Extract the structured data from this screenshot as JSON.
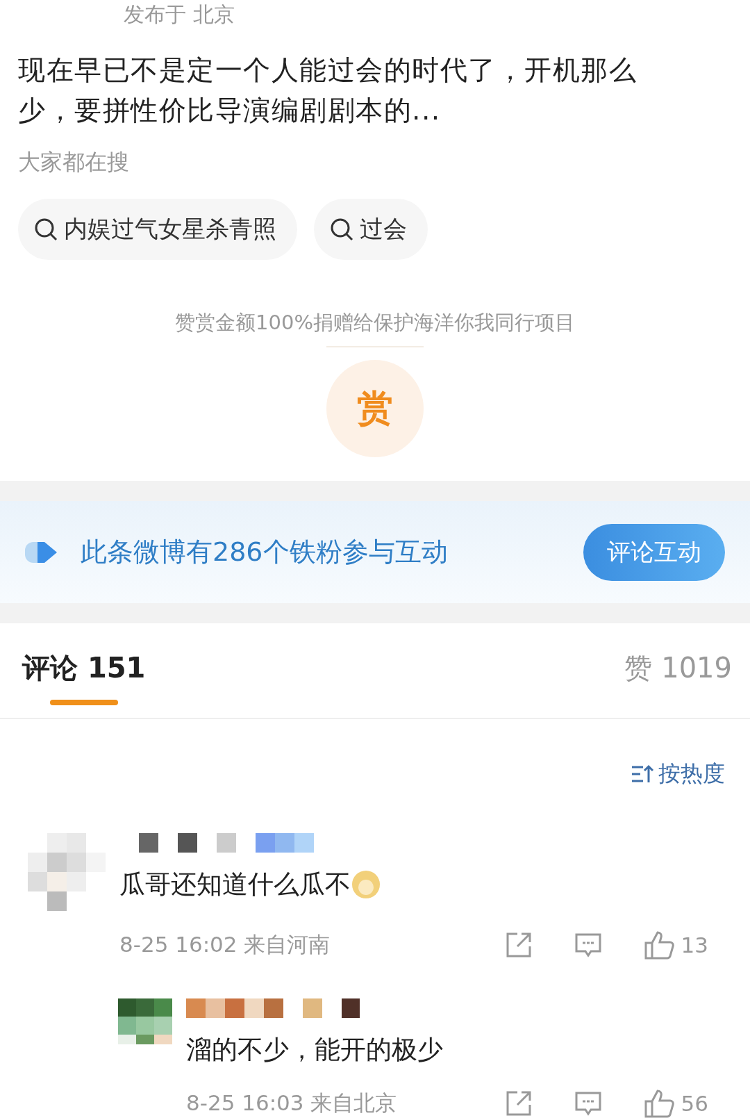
{
  "post": {
    "location": "发布于 北京",
    "text": "现在早已不是定一个人能过会的时代了，开机那么少，要拼性价比导演编剧剧本的..."
  },
  "hot_search": {
    "title": "大家都在搜",
    "chips": [
      "内娱过气女星杀青照",
      "过会"
    ]
  },
  "reward": {
    "note": "赞赏金额100%捐赠给保护海洋你我同行项目",
    "button": "赏"
  },
  "fans_banner": {
    "text": "此条微博有286个铁粉参与互动",
    "button": "评论互动"
  },
  "tabs": [
    {
      "label": "评论 151",
      "selected": true
    },
    {
      "label": "赞 1019",
      "selected": false
    }
  ],
  "sort": "按热度",
  "comments": [
    {
      "text": "瓜哥还知道什么瓜不",
      "emoji": true,
      "time": "8-25 16:02",
      "source": "来自河南",
      "likes": "13",
      "reply": false
    },
    {
      "text": "溜的不少，能开的极少",
      "emoji": false,
      "time": "8-25 16:03",
      "source": "来自北京",
      "likes": "56",
      "reply": true
    }
  ]
}
